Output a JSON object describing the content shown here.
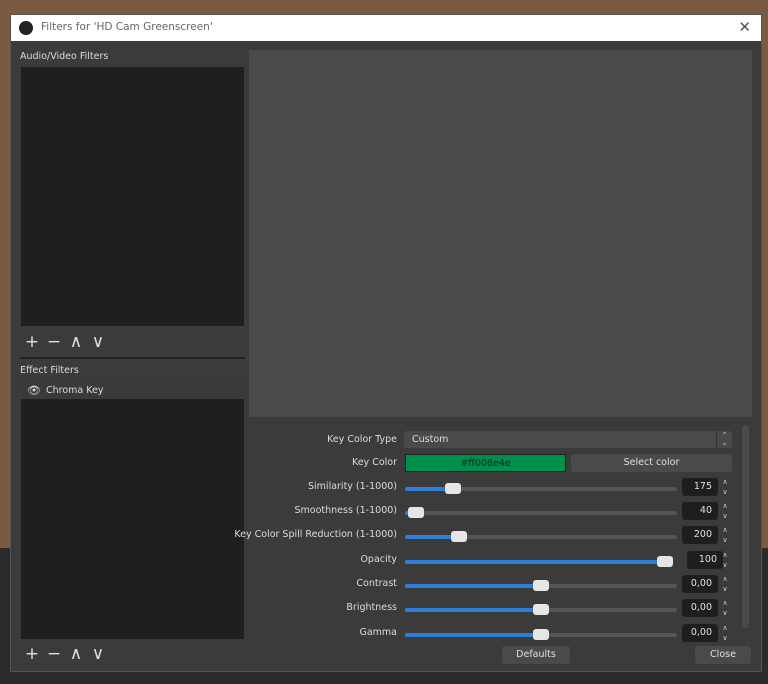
{
  "dialog": {
    "title": "Filters for 'HD Cam Greenscreen'",
    "close": "✕"
  },
  "left": {
    "av_title": "Audio/Video Filters",
    "effect_title": "Effect Filters",
    "toolbar": {
      "add": "+",
      "remove": "−",
      "up": "∧",
      "down": "∨"
    },
    "effect_filters": [
      {
        "name": "Chroma Key",
        "visible": true
      }
    ]
  },
  "props": {
    "key_color_type": {
      "label": "Key Color Type",
      "value": "Custom"
    },
    "key_color": {
      "label": "Key Color",
      "value": "#ff008e4e",
      "swatch": "#008e4e",
      "button": "Select color"
    },
    "sliders": [
      {
        "label": "Similarity (1-1000)",
        "value": "175",
        "fraction": 0.175
      },
      {
        "label": "Smoothness (1-1000)",
        "value": "40",
        "fraction": 0.04
      },
      {
        "label": "Key Color Spill Reduction (1-1000)",
        "value": "200",
        "fraction": 0.2
      },
      {
        "label": "Opacity",
        "value": "100",
        "fraction": 1.0
      },
      {
        "label": "Contrast",
        "value": "0,00",
        "fraction": 0.5
      },
      {
        "label": "Brightness",
        "value": "0,00",
        "fraction": 0.5
      },
      {
        "label": "Gamma",
        "value": "0,00",
        "fraction": 0.5
      }
    ]
  },
  "buttons": {
    "defaults": "Defaults",
    "close": "Close"
  }
}
